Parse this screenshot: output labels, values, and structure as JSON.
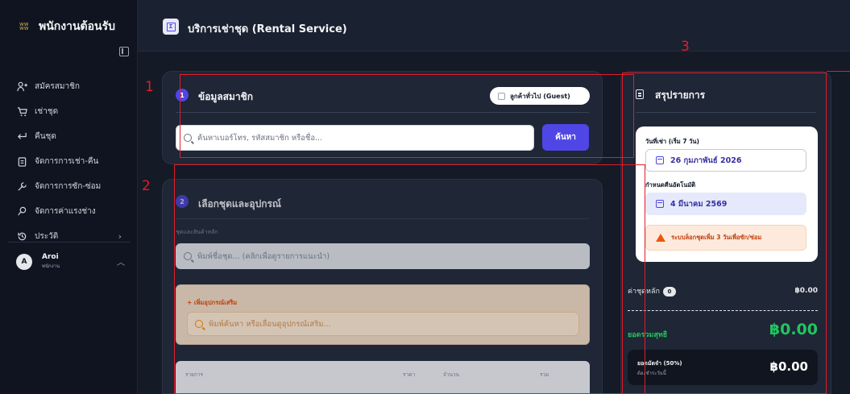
{
  "sidebar": {
    "brand_title": "พนักงานต้อนรับ",
    "items": [
      {
        "label": "สมัครสมาชิก",
        "icon": "user-plus-icon"
      },
      {
        "label": "เช่าชุด",
        "icon": "cart-icon"
      },
      {
        "label": "คืนชุด",
        "icon": "return-icon"
      },
      {
        "label": "จัดการการเช่า-คืน",
        "icon": "clipboard-icon"
      },
      {
        "label": "จัดการการซัก-ซ่อม",
        "icon": "wrench-icon"
      },
      {
        "label": "จัดการค่าแรงช่าง",
        "icon": "coins-icon"
      },
      {
        "label": "ประวัติ",
        "icon": "history-icon"
      }
    ],
    "user": {
      "initial": "A",
      "name": "Aroi",
      "role": "พนักงาน"
    }
  },
  "topbar": {
    "title": "บริการเช่าชุด (Rental Service)"
  },
  "member_card": {
    "step": "1",
    "title": "ข้อมูลสมาชิก",
    "guest_label": "ลูกค้าทั่วไป (Guest)",
    "search_placeholder": "ค้นหาเบอร์โทร, รหัสสมาชิก หรือชื่อ...",
    "search_button": "ค้นหา"
  },
  "items_card": {
    "step": "2",
    "title": "เลือกชุดและอุปกรณ์",
    "main_label": "ชุดและสินค้าหลัก",
    "main_placeholder": "พิมพ์ชื่อชุด... (คลิกเพื่อดูรายการแนะนำ)",
    "accessory_label": "+ เพิ่มอุปกรณ์เสริม",
    "accessory_placeholder": "พิมพ์ค้นหา หรือเลื่อนดูอุปกรณ์เสริม...",
    "table_headers": [
      "รายการ",
      "ราคา",
      "จำนวน",
      "รวม"
    ]
  },
  "summary": {
    "title": "สรุปรายการ",
    "rent_date_label": "วันที่เช่า (เริ่ม 7 วัน)",
    "rent_date": "26 กุมภาพันธ์ 2026",
    "return_label": "กำหนดคืนอัตโนมัติ",
    "return_date": "4 มีนาคม 2569",
    "warning": "ระบบล็อกชุดเพิ่ม 3 วันเพื่อซัก/ซ่อม",
    "main_cost_label": "ค่าชุดหลัก",
    "main_cost_count": "0",
    "main_cost_value": "฿0.00",
    "net_label": "ยอดรวมสุทธิ",
    "net_value": "฿0.00",
    "deposit_label": "ยอดมัดจำ (50%)",
    "deposit_sub": "ต้องชำระวันนี้",
    "deposit_value": "฿0.00"
  },
  "annotations": [
    "1",
    "2",
    "3"
  ],
  "colors": {
    "accent": "#4f46e5",
    "annotation": "#e11d2a",
    "success": "#22c55e",
    "warning": "#ea580c"
  }
}
